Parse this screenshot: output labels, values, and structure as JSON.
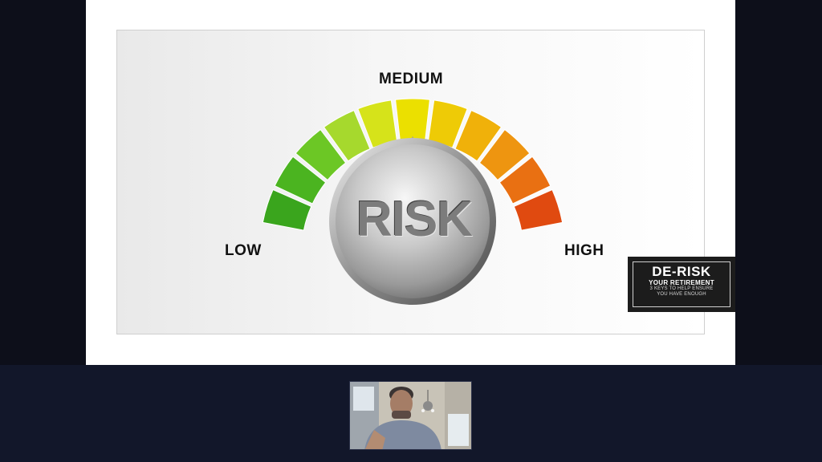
{
  "slide": {
    "gauge": {
      "label_low": "LOW",
      "label_medium": "MEDIUM",
      "label_high": "HIGH",
      "knob_text": "RISK",
      "colors": [
        "#3aa51d",
        "#4bb420",
        "#6cc725",
        "#a6d92d",
        "#d6e31a",
        "#ebe000",
        "#eecb06",
        "#f0b10a",
        "#ee9510",
        "#e97012",
        "#e04a10"
      ]
    }
  },
  "brand": {
    "title": "DE-RISK",
    "subtitle": "YOUR RETIREMENT",
    "tagline_line1": "3 KEYS TO HELP ENSURE",
    "tagline_line2": "YOU HAVE ENOUGH"
  },
  "participant": {
    "video": "participant-webcam-feed"
  }
}
